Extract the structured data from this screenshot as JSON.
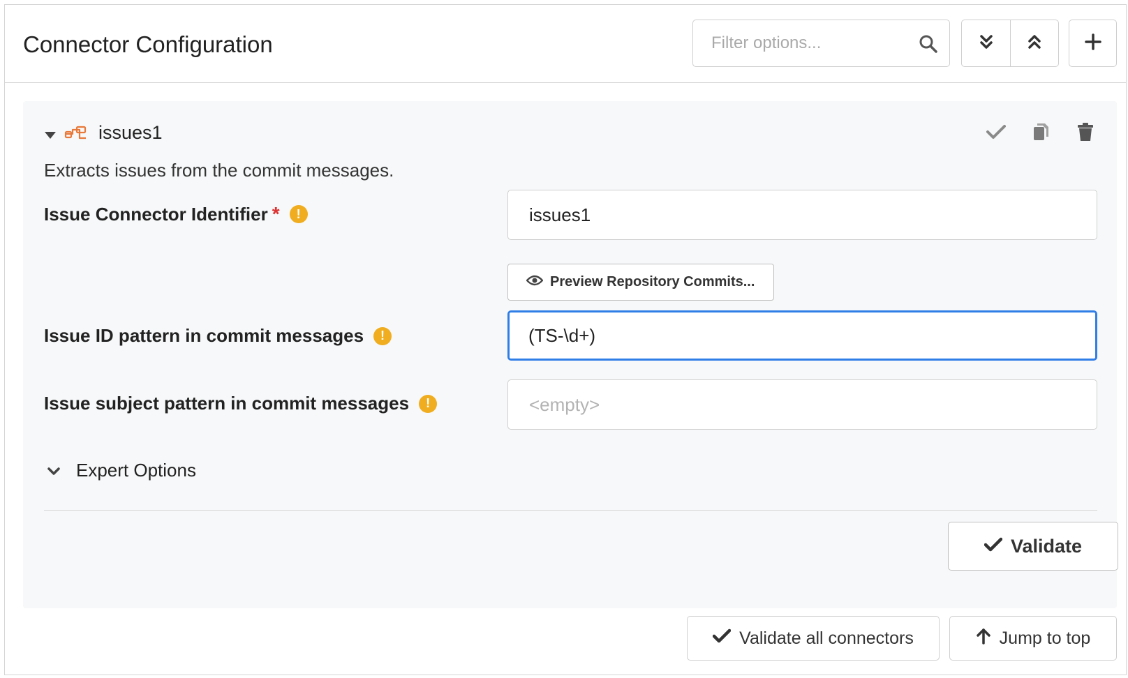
{
  "header": {
    "title": "Connector Configuration",
    "filter_placeholder": "Filter options..."
  },
  "connector": {
    "name": "issues1",
    "description": "Extracts issues from the commit messages.",
    "fields": [
      {
        "label": "Issue Connector Identifier",
        "required": true,
        "value": "issues1",
        "placeholder": ""
      },
      {
        "label": "Issue ID pattern in commit messages",
        "required": false,
        "value": "(TS-\\d+)",
        "placeholder": ""
      },
      {
        "label": "Issue subject pattern in commit messages",
        "required": false,
        "value": "",
        "placeholder": "<empty>"
      }
    ],
    "required_marker": "*",
    "warning_marker": "!",
    "preview_button": "Preview Repository Commits...",
    "expert_options": "Expert Options",
    "validate_button": "Validate"
  },
  "footer": {
    "validate_all": "Validate all connectors",
    "jump_to_top": "Jump to top"
  },
  "colors": {
    "accent": "#2f7ee7",
    "warning": "#f0ad1f",
    "required": "#dd3333",
    "connector_icon": "#e8793a"
  }
}
